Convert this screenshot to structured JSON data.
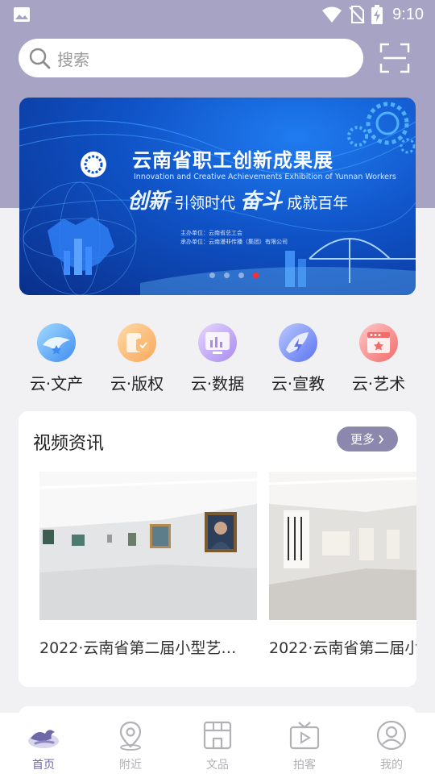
{
  "status_bar": {
    "time": "9:10"
  },
  "search": {
    "placeholder": "搜索"
  },
  "banner": {
    "title": "云南省职工创新成果展",
    "subtitle_en": "Innovation and Creative Achievements Exhibition of Yunnan Workers",
    "slogan_1": "创新",
    "slogan_2": "引领时代",
    "slogan_3": "奋斗",
    "slogan_4": "成就百年",
    "organizer": "主办单位：云南省总工会",
    "undertaker": "承办单位：云南漫非传播（集团）有限公司",
    "page_count": 4,
    "active_page": 4
  },
  "categories": [
    {
      "label": "云·文产",
      "icon": "culture-industry-icon"
    },
    {
      "label": "云·版权",
      "icon": "copyright-icon"
    },
    {
      "label": "云·数据",
      "icon": "data-chart-icon"
    },
    {
      "label": "云·宣教",
      "icon": "education-icon"
    },
    {
      "label": "云·艺术",
      "icon": "art-icon"
    }
  ],
  "video_section": {
    "title": "视频资讯",
    "more_label": "更多",
    "items": [
      {
        "caption": "2022·云南省第二届小型艺…"
      },
      {
        "caption": "2022·云南省第二届小"
      }
    ]
  },
  "tabbar": [
    {
      "label": "首页",
      "active": true
    },
    {
      "label": "附近",
      "active": false
    },
    {
      "label": "文品",
      "active": false
    },
    {
      "label": "拍客",
      "active": false
    },
    {
      "label": "我的",
      "active": false
    }
  ],
  "colors": {
    "header_bg": "#a7a3c4",
    "accent": "#8b87ad",
    "tab_active": "#6f68a8",
    "tab_inactive": "#b1b1b6",
    "carousel_active_dot": "#ff2d2d"
  }
}
